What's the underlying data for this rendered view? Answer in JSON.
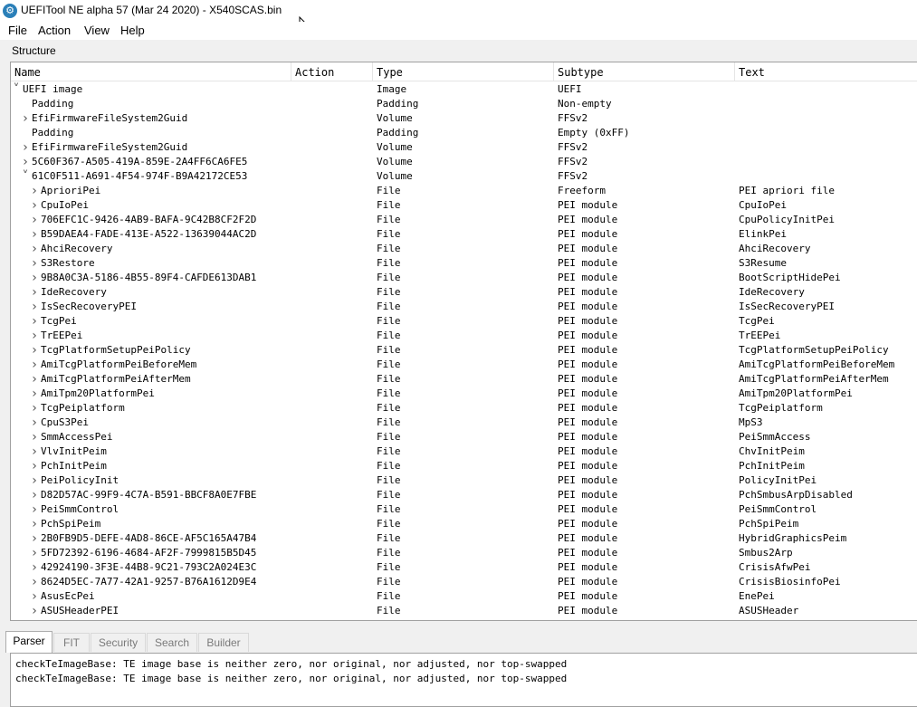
{
  "window": {
    "title": "UEFITool NE alpha 57 (Mar 24 2020) - X540SCAS.bin",
    "icon": "gear-icon"
  },
  "menu": [
    "File",
    "Action",
    "View",
    "Help"
  ],
  "structure": {
    "group_title": "Structure",
    "columns": [
      "Name",
      "Action",
      "Type",
      "Subtype",
      "Text"
    ],
    "rows": [
      {
        "name": "UEFI image",
        "action": "",
        "type": "Image",
        "subtype": "UEFI",
        "text": "",
        "expander": "expanded",
        "level": 0
      },
      {
        "name": "Padding",
        "action": "",
        "type": "Padding",
        "subtype": "Non-empty",
        "text": "",
        "expander": "none",
        "level": 1
      },
      {
        "name": "EfiFirmwareFileSystem2Guid",
        "action": "",
        "type": "Volume",
        "subtype": "FFSv2",
        "text": "",
        "expander": "collapsed",
        "level": 1
      },
      {
        "name": "Padding",
        "action": "",
        "type": "Padding",
        "subtype": "Empty (0xFF)",
        "text": "",
        "expander": "none",
        "level": 1
      },
      {
        "name": "EfiFirmwareFileSystem2Guid",
        "action": "",
        "type": "Volume",
        "subtype": "FFSv2",
        "text": "",
        "expander": "collapsed",
        "level": 1
      },
      {
        "name": "5C60F367-A505-419A-859E-2A4FF6CA6FE5",
        "action": "",
        "type": "Volume",
        "subtype": "FFSv2",
        "text": "",
        "expander": "collapsed",
        "level": 1
      },
      {
        "name": "61C0F511-A691-4F54-974F-B9A42172CE53",
        "action": "",
        "type": "Volume",
        "subtype": "FFSv2",
        "text": "",
        "expander": "expanded",
        "level": 1
      },
      {
        "name": "AprioriPei",
        "action": "",
        "type": "File",
        "subtype": "Freeform",
        "text": "PEI apriori file",
        "expander": "collapsed",
        "level": 2
      },
      {
        "name": "CpuIoPei",
        "action": "",
        "type": "File",
        "subtype": "PEI module",
        "text": "CpuIoPei",
        "expander": "collapsed",
        "level": 2
      },
      {
        "name": "706EFC1C-9426-4AB9-BAFA-9C42B8CF2F2D",
        "action": "",
        "type": "File",
        "subtype": "PEI module",
        "text": "CpuPolicyInitPei",
        "expander": "collapsed",
        "level": 2
      },
      {
        "name": "B59DAEA4-FADE-413E-A522-13639044AC2D",
        "action": "",
        "type": "File",
        "subtype": "PEI module",
        "text": "ElinkPei",
        "expander": "collapsed",
        "level": 2
      },
      {
        "name": "AhciRecovery",
        "action": "",
        "type": "File",
        "subtype": "PEI module",
        "text": "AhciRecovery",
        "expander": "collapsed",
        "level": 2
      },
      {
        "name": "S3Restore",
        "action": "",
        "type": "File",
        "subtype": "PEI module",
        "text": "S3Resume",
        "expander": "collapsed",
        "level": 2
      },
      {
        "name": "9B8A0C3A-5186-4B55-89F4-CAFDE613DAB1",
        "action": "",
        "type": "File",
        "subtype": "PEI module",
        "text": "BootScriptHidePei",
        "expander": "collapsed",
        "level": 2
      },
      {
        "name": "IdeRecovery",
        "action": "",
        "type": "File",
        "subtype": "PEI module",
        "text": "IdeRecovery",
        "expander": "collapsed",
        "level": 2
      },
      {
        "name": "IsSecRecoveryPEI",
        "action": "",
        "type": "File",
        "subtype": "PEI module",
        "text": "IsSecRecoveryPEI",
        "expander": "collapsed",
        "level": 2
      },
      {
        "name": "TcgPei",
        "action": "",
        "type": "File",
        "subtype": "PEI module",
        "text": "TcgPei",
        "expander": "collapsed",
        "level": 2
      },
      {
        "name": "TrEEPei",
        "action": "",
        "type": "File",
        "subtype": "PEI module",
        "text": "TrEEPei",
        "expander": "collapsed",
        "level": 2
      },
      {
        "name": "TcgPlatformSetupPeiPolicy",
        "action": "",
        "type": "File",
        "subtype": "PEI module",
        "text": "TcgPlatformSetupPeiPolicy",
        "expander": "collapsed",
        "level": 2
      },
      {
        "name": "AmiTcgPlatformPeiBeforeMem",
        "action": "",
        "type": "File",
        "subtype": "PEI module",
        "text": "AmiTcgPlatformPeiBeforeMem",
        "expander": "collapsed",
        "level": 2
      },
      {
        "name": "AmiTcgPlatformPeiAfterMem",
        "action": "",
        "type": "File",
        "subtype": "PEI module",
        "text": "AmiTcgPlatformPeiAfterMem",
        "expander": "collapsed",
        "level": 2
      },
      {
        "name": "AmiTpm20PlatformPei",
        "action": "",
        "type": "File",
        "subtype": "PEI module",
        "text": "AmiTpm20PlatformPei",
        "expander": "collapsed",
        "level": 2
      },
      {
        "name": "TcgPeiplatform",
        "action": "",
        "type": "File",
        "subtype": "PEI module",
        "text": "TcgPeiplatform",
        "expander": "collapsed",
        "level": 2
      },
      {
        "name": "CpuS3Pei",
        "action": "",
        "type": "File",
        "subtype": "PEI module",
        "text": "MpS3",
        "expander": "collapsed",
        "level": 2
      },
      {
        "name": "SmmAccessPei",
        "action": "",
        "type": "File",
        "subtype": "PEI module",
        "text": "PeiSmmAccess",
        "expander": "collapsed",
        "level": 2
      },
      {
        "name": "VlvInitPeim",
        "action": "",
        "type": "File",
        "subtype": "PEI module",
        "text": "ChvInitPeim",
        "expander": "collapsed",
        "level": 2
      },
      {
        "name": "PchInitPeim",
        "action": "",
        "type": "File",
        "subtype": "PEI module",
        "text": "PchInitPeim",
        "expander": "collapsed",
        "level": 2
      },
      {
        "name": "PeiPolicyInit",
        "action": "",
        "type": "File",
        "subtype": "PEI module",
        "text": "PolicyInitPei",
        "expander": "collapsed",
        "level": 2
      },
      {
        "name": "D82D57AC-99F9-4C7A-B591-BBCF8A0E7FBE",
        "action": "",
        "type": "File",
        "subtype": "PEI module",
        "text": "PchSmbusArpDisabled",
        "expander": "collapsed",
        "level": 2
      },
      {
        "name": "PeiSmmControl",
        "action": "",
        "type": "File",
        "subtype": "PEI module",
        "text": "PeiSmmControl",
        "expander": "collapsed",
        "level": 2
      },
      {
        "name": "PchSpiPeim",
        "action": "",
        "type": "File",
        "subtype": "PEI module",
        "text": "PchSpiPeim",
        "expander": "collapsed",
        "level": 2
      },
      {
        "name": "2B0FB9D5-DEFE-4AD8-86CE-AF5C165A47B4",
        "action": "",
        "type": "File",
        "subtype": "PEI module",
        "text": "HybridGraphicsPeim",
        "expander": "collapsed",
        "level": 2
      },
      {
        "name": "5FD72392-6196-4684-AF2F-7999815B5D45",
        "action": "",
        "type": "File",
        "subtype": "PEI module",
        "text": "Smbus2Arp",
        "expander": "collapsed",
        "level": 2
      },
      {
        "name": "42924190-3F3E-44B8-9C21-793C2A024E3C",
        "action": "",
        "type": "File",
        "subtype": "PEI module",
        "text": "CrisisAfwPei",
        "expander": "collapsed",
        "level": 2
      },
      {
        "name": "8624D5EC-7A77-42A1-9257-B76A1612D9E4",
        "action": "",
        "type": "File",
        "subtype": "PEI module",
        "text": "CrisisBiosinfoPei",
        "expander": "collapsed",
        "level": 2
      },
      {
        "name": "AsusEcPei",
        "action": "",
        "type": "File",
        "subtype": "PEI module",
        "text": "EnePei",
        "expander": "collapsed",
        "level": 2
      },
      {
        "name": "ASUSHeaderPEI",
        "action": "",
        "type": "File",
        "subtype": "PEI module",
        "text": "ASUSHeader",
        "expander": "collapsed",
        "level": 2
      }
    ]
  },
  "tabs": {
    "items": [
      "Parser",
      "FIT",
      "Security",
      "Search",
      "Builder"
    ],
    "active": "Parser"
  },
  "messages": [
    "checkTeImageBase: TE image base is neither zero, nor original, nor adjusted, nor top-swapped",
    "checkTeImageBase: TE image base is neither zero, nor original, nor adjusted, nor top-swapped"
  ]
}
